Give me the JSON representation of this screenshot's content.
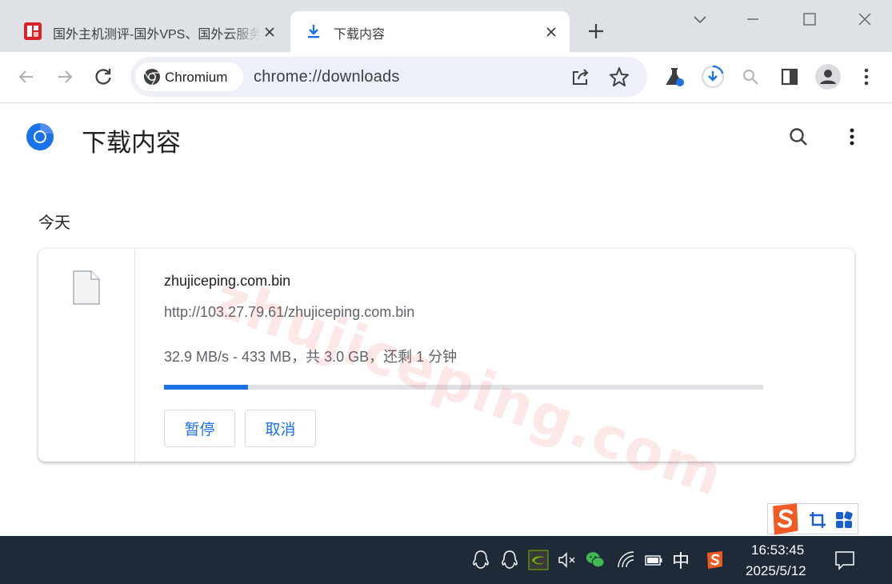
{
  "browser": {
    "tabs": [
      {
        "title": "国外主机测评-国外VPS、国外云服务器",
        "active": false
      },
      {
        "title": "下载内容",
        "active": true
      }
    ],
    "omnibox": {
      "chip_label": "Chromium",
      "url": "chrome://downloads"
    }
  },
  "page": {
    "title": "下载内容",
    "section_label": "今天",
    "download": {
      "file_name": "zhujiceping.com.bin",
      "url": "http://103.27.79.61/zhujiceping.com.bin",
      "status": "32.9 MB/s - 433 MB，共 3.0 GB，还剩 1 分钟",
      "progress_fraction": 0.14,
      "pause_label": "暂停",
      "cancel_label": "取消"
    },
    "watermark": "zhujiceping.com"
  },
  "taskbar": {
    "ime_label": "中",
    "time": "16:53:45",
    "date": "2025/5/12"
  },
  "colors": {
    "accent": "#1a73e8",
    "tabstrip": "#dee1e6",
    "omnibox": "#edf0f6",
    "taskbar": "#1f2a38",
    "sogou": "#f05b24"
  }
}
